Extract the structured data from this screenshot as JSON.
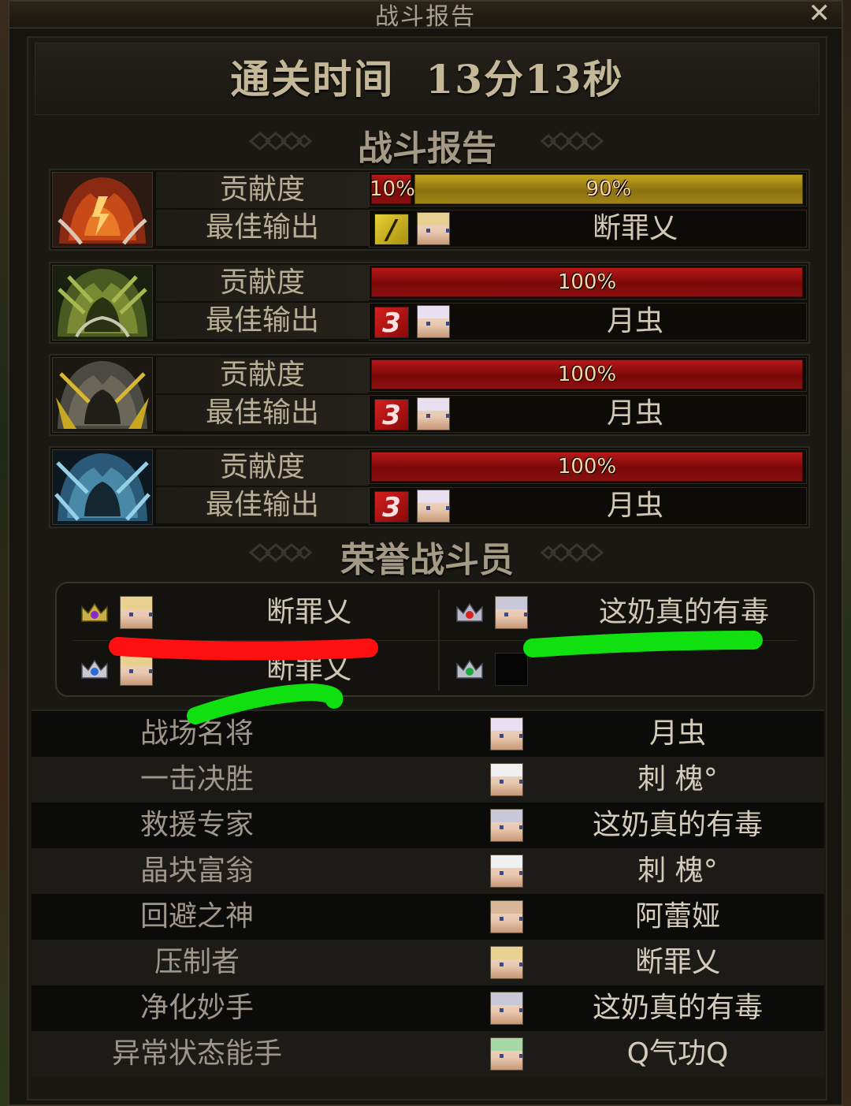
{
  "window": {
    "title": "战斗报告",
    "close_label": "✕"
  },
  "clear_time": {
    "label": "通关时间",
    "value": "13分13秒"
  },
  "sections": {
    "battle_report": "战斗报告",
    "honor_fighters": "荣誉战斗员"
  },
  "bosses": [
    {
      "icon": "fire-boss-icon",
      "contribution_label": "贡献度",
      "best_output_label": "最佳输出",
      "contribution": [
        {
          "text": "10%",
          "value": 10,
          "color": "#b81818"
        },
        {
          "text": "90%",
          "value": 90,
          "color": "#c4a21c"
        }
      ],
      "job_icon": "gold-job-icon",
      "job_glyph": "/",
      "player": "断罪乂"
    },
    {
      "icon": "forest-boss-icon",
      "contribution_label": "贡献度",
      "best_output_label": "最佳输出",
      "contribution": [
        {
          "text": "100%",
          "value": 100,
          "color": "#b81818"
        }
      ],
      "job_icon": "red-job-icon",
      "job_glyph": "3",
      "player": "月虫"
    },
    {
      "icon": "gold-boss-icon",
      "contribution_label": "贡献度",
      "best_output_label": "最佳输出",
      "contribution": [
        {
          "text": "100%",
          "value": 100,
          "color": "#b81818"
        }
      ],
      "job_icon": "red-job-icon",
      "job_glyph": "3",
      "player": "月虫"
    },
    {
      "icon": "ice-boss-icon",
      "contribution_label": "贡献度",
      "best_output_label": "最佳输出",
      "contribution": [
        {
          "text": "100%",
          "value": 100,
          "color": "#b81818"
        }
      ],
      "job_icon": "red-job-icon",
      "job_glyph": "3",
      "player": "月虫"
    }
  ],
  "honor": [
    {
      "crown": "purple-crown-icon",
      "name": "断罪乂"
    },
    {
      "crown": "red-crown-icon",
      "name": "这奶真的有毒"
    },
    {
      "crown": "blue-crown-icon",
      "name": "断罪乂"
    },
    {
      "crown": "green-crown-icon",
      "name": ""
    }
  ],
  "awards": [
    {
      "title": "战场名将",
      "player": "月虫"
    },
    {
      "title": "一击决胜",
      "player": "刺 槐°"
    },
    {
      "title": "救援专家",
      "player": "这奶真的有毒"
    },
    {
      "title": "晶块富翁",
      "player": "刺 槐°"
    },
    {
      "title": "回避之神",
      "player": "阿蕾娅"
    },
    {
      "title": "压制者",
      "player": "断罪乂"
    },
    {
      "title": "净化妙手",
      "player": "这奶真的有毒"
    },
    {
      "title": "异常状态能手",
      "player": "Q气功Q"
    }
  ],
  "colors": {
    "highlight_red": "#ff1010",
    "highlight_green": "#10e010",
    "bar_red": "#b81818",
    "bar_gold": "#c4a21c"
  }
}
